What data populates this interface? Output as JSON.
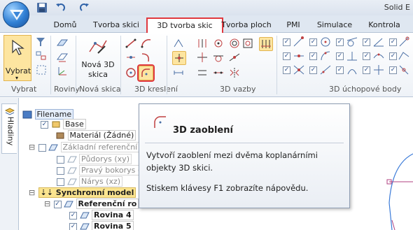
{
  "app": {
    "title": "Solid E"
  },
  "tabs": [
    {
      "label": "Domů"
    },
    {
      "label": "Tvorba skici"
    },
    {
      "label": "3D tvorba skic"
    },
    {
      "label": "Tvorba ploch"
    },
    {
      "label": "PMI"
    },
    {
      "label": "Simulace"
    },
    {
      "label": "Kontrola"
    }
  ],
  "ribbon": {
    "select_label": "Vybrat",
    "new_sketch_label_1": "Nová 3D",
    "new_sketch_label_2": "skica",
    "groups": {
      "vybrat": "Vybrat",
      "roviny": "Roviny",
      "nova_skica": "Nová skica",
      "kresleni": "3D kreslení",
      "vazby": "3D vazby",
      "uchopove": "3D úchopové body"
    }
  },
  "side_tab": {
    "label": "Hladiny"
  },
  "tree": {
    "filename": "Filename",
    "base": "Base",
    "material": "Materiál (Žádné)",
    "ref_planes": "Základní referenční r",
    "pudorys": "Půdorys (xy)",
    "pravy": "Pravý bokorys (y",
    "narys": "Nárys (xz)",
    "sync": "Synchronní model",
    "ref_ro": "Referenční ro",
    "rovina4": "Rovina 4",
    "rovina5": "Rovina 5"
  },
  "tooltip": {
    "title": "3D zaoblení",
    "description": "Vytvoří zaoblení mezi dvěma koplanárními objekty 3D skici.",
    "hint": "Stiskem klávesy F1 zobrazíte nápovědu."
  },
  "colors": {
    "accent_red": "#e0383f",
    "highlight_yellow": "#fde5a0",
    "ribbon_bg": "#dfe7f1"
  }
}
